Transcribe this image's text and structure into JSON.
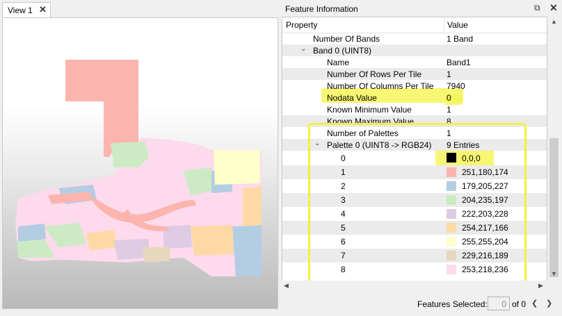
{
  "view_tab": {
    "label": "View 1",
    "close_icon": "close-icon"
  },
  "panel": {
    "title": "Feature Information",
    "float_icon": "float-icon",
    "close_icon": "close-icon"
  },
  "table": {
    "headers": {
      "property": "Property",
      "value": "Value"
    },
    "rows": [
      {
        "property": "Number Of Bands",
        "value": "1 Band",
        "level": 2
      },
      {
        "property": "Band 0 (UINT8)",
        "value": "",
        "level": 1,
        "expanded": true
      },
      {
        "property": "Name",
        "value": "Band1",
        "level": 3
      },
      {
        "property": "Number Of Rows Per Tile",
        "value": "1",
        "level": 3
      },
      {
        "property": "Number Of Columns Per Tile",
        "value": "7940",
        "level": 3
      },
      {
        "property": "Nodata Value",
        "value": "0",
        "level": 3,
        "highlight": true
      },
      {
        "property": "Known Minimum Value",
        "value": "1",
        "level": 3
      },
      {
        "property": "Known Maximum Value",
        "value": "8",
        "level": 3
      },
      {
        "property": "Number of Palettes",
        "value": "1",
        "level": 3
      },
      {
        "property": "Palette 0 (UINT8 -> RGB24)",
        "value": "9 Entries",
        "level": 2,
        "expanded": true
      }
    ],
    "palette": [
      {
        "index": "0",
        "value": "0,0,0",
        "color": "#000000"
      },
      {
        "index": "1",
        "value": "251,180,174",
        "color": "#fbb4ae"
      },
      {
        "index": "2",
        "value": "179,205,227",
        "color": "#b3cde3"
      },
      {
        "index": "3",
        "value": "204,235,197",
        "color": "#ccebc5"
      },
      {
        "index": "4",
        "value": "222,203,228",
        "color": "#decbe4"
      },
      {
        "index": "5",
        "value": "254,217,166",
        "color": "#fed9a6"
      },
      {
        "index": "6",
        "value": "255,255,204",
        "color": "#ffffcc"
      },
      {
        "index": "7",
        "value": "229,216,189",
        "color": "#e5d8bd"
      },
      {
        "index": "8",
        "value": "253,218,236",
        "color": "#fddaec"
      }
    ]
  },
  "status": {
    "label": "Features Selected:",
    "selected": "0",
    "of_text": "of 0"
  },
  "colors": {
    "highlight": "#f7f55a",
    "box": "#f3f040"
  }
}
